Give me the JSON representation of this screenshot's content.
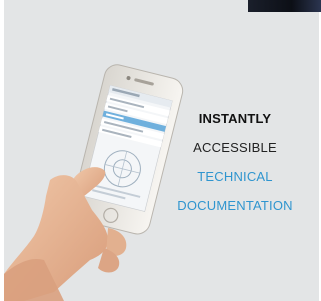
{
  "tagline": {
    "line1": "INSTANTLY",
    "line2": "ACCESSIBLE",
    "line3": "TECHNICAL",
    "line4": "DOCUMENTATION"
  },
  "colors": {
    "background": "#e3e5e6",
    "accent": "#2f95cf",
    "text_dark": "#111111"
  }
}
